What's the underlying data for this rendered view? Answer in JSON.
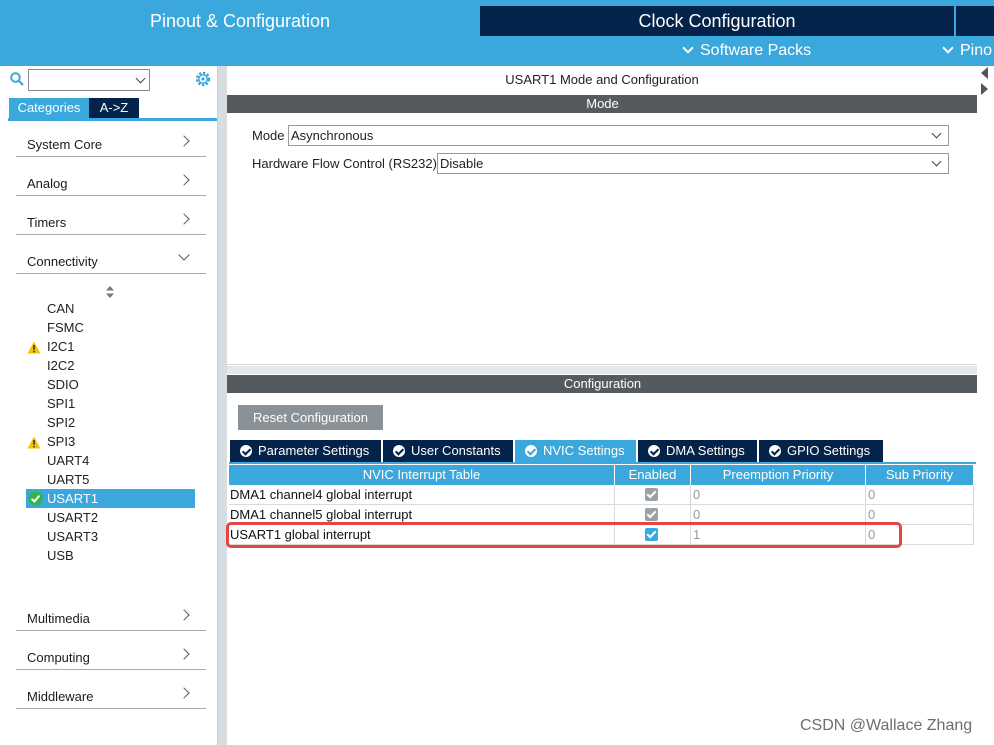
{
  "top_tabs": {
    "pinout": "Pinout & Configuration",
    "clock": "Clock Configuration"
  },
  "sub_menu": {
    "software_packs": "Software Packs",
    "pinout": "Pino"
  },
  "left_panel": {
    "tab_categories": "Categories",
    "tab_az": "A->Z",
    "categories": [
      {
        "label": "System Core",
        "expanded": false
      },
      {
        "label": "Analog",
        "expanded": false
      },
      {
        "label": "Timers",
        "expanded": false
      },
      {
        "label": "Connectivity",
        "expanded": true
      },
      {
        "label": "Multimedia",
        "expanded": false
      },
      {
        "label": "Computing",
        "expanded": false
      },
      {
        "label": "Middleware",
        "expanded": false
      }
    ],
    "peripherals": [
      {
        "label": "CAN",
        "status": "none"
      },
      {
        "label": "FSMC",
        "status": "none"
      },
      {
        "label": "I2C1",
        "status": "warning"
      },
      {
        "label": "I2C2",
        "status": "none"
      },
      {
        "label": "SDIO",
        "status": "none"
      },
      {
        "label": "SPI1",
        "status": "none"
      },
      {
        "label": "SPI2",
        "status": "none"
      },
      {
        "label": "SPI3",
        "status": "warning"
      },
      {
        "label": "UART4",
        "status": "none"
      },
      {
        "label": "UART5",
        "status": "none"
      },
      {
        "label": "USART1",
        "status": "ok"
      },
      {
        "label": "USART2",
        "status": "none"
      },
      {
        "label": "USART3",
        "status": "none"
      },
      {
        "label": "USB",
        "status": "none"
      }
    ],
    "selected": "USART1"
  },
  "mode_panel": {
    "title": "USART1 Mode and Configuration",
    "header": "Mode",
    "mode_label": "Mode",
    "mode_value": "Asynchronous",
    "flow_label": "Hardware Flow Control (RS232)",
    "flow_value": "Disable"
  },
  "config_panel": {
    "header": "Configuration",
    "reset_button": "Reset Configuration",
    "tabs": [
      {
        "label": "Parameter Settings",
        "active": false
      },
      {
        "label": "User Constants",
        "active": false
      },
      {
        "label": "NVIC Settings",
        "active": true
      },
      {
        "label": "DMA Settings",
        "active": false
      },
      {
        "label": "GPIO Settings",
        "active": false
      }
    ]
  },
  "nvic_table": {
    "columns": [
      "NVIC Interrupt Table",
      "Enabled",
      "Preemption Priority",
      "Sub Priority"
    ],
    "rows": [
      {
        "name": "DMA1 channel4 global interrupt",
        "enabled": true,
        "editable": false,
        "preemption": "0",
        "sub": "0"
      },
      {
        "name": "DMA1 channel5 global interrupt",
        "enabled": true,
        "editable": false,
        "preemption": "0",
        "sub": "0"
      },
      {
        "name": "USART1 global interrupt",
        "enabled": true,
        "editable": true,
        "preemption": "1",
        "sub": "0"
      }
    ]
  },
  "watermark": "CSDN @Wallace Zhang",
  "colors": {
    "accent": "#3aa8dc",
    "navy": "#03234b",
    "header_gray": "#555a5e",
    "highlight_red": "#e64545",
    "warning_yellow": "#f5c400",
    "ok_green": "#34b34a"
  }
}
